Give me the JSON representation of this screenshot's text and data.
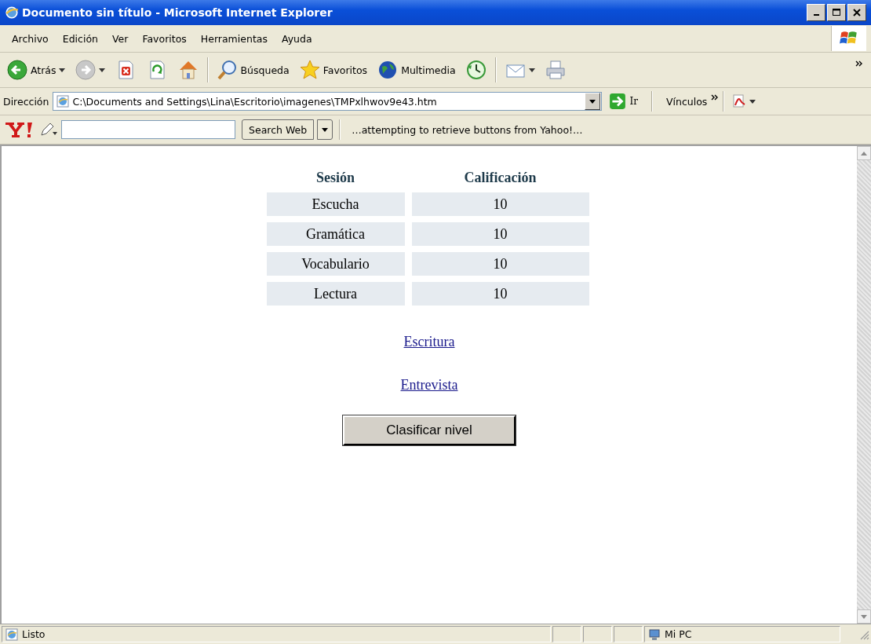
{
  "window": {
    "title": "Documento sin título - Microsoft Internet Explorer"
  },
  "menu": [
    "Archivo",
    "Edición",
    "Ver",
    "Favoritos",
    "Herramientas",
    "Ayuda"
  ],
  "toolbar": [
    {
      "kind": "back",
      "label": "Atrás",
      "dropdown": true
    },
    {
      "kind": "forward",
      "dropdown": true
    },
    {
      "kind": "stop"
    },
    {
      "kind": "refresh"
    },
    {
      "kind": "home"
    },
    {
      "kind": "separator"
    },
    {
      "kind": "search",
      "label": "Búsqueda"
    },
    {
      "kind": "favorites",
      "label": "Favoritos"
    },
    {
      "kind": "media",
      "label": "Multimedia"
    },
    {
      "kind": "history"
    },
    {
      "kind": "separator"
    },
    {
      "kind": "mail",
      "dropdown": true
    },
    {
      "kind": "print"
    }
  ],
  "address_bar": {
    "label": "Dirección",
    "url": "C:\\Documents and Settings\\Lina\\Escritorio\\imagenes\\TMPxlhwov9e43.htm",
    "go": "Ir",
    "links": "Vínculos"
  },
  "yahoo_bar": {
    "search_button": "Search Web",
    "message": "…attempting to retrieve buttons from Yahoo!…"
  },
  "table": {
    "columns": [
      "Sesión",
      "Calificación"
    ],
    "rows": [
      [
        "Escucha",
        "10"
      ],
      [
        "Gramática",
        "10"
      ],
      [
        "Vocabulario",
        "10"
      ],
      [
        "Lectura",
        "10"
      ]
    ]
  },
  "links": [
    "Escritura",
    "Entrevista"
  ],
  "button": "Clasificar nivel",
  "status_bar": {
    "text": "Listo",
    "zone": "Mi PC"
  }
}
